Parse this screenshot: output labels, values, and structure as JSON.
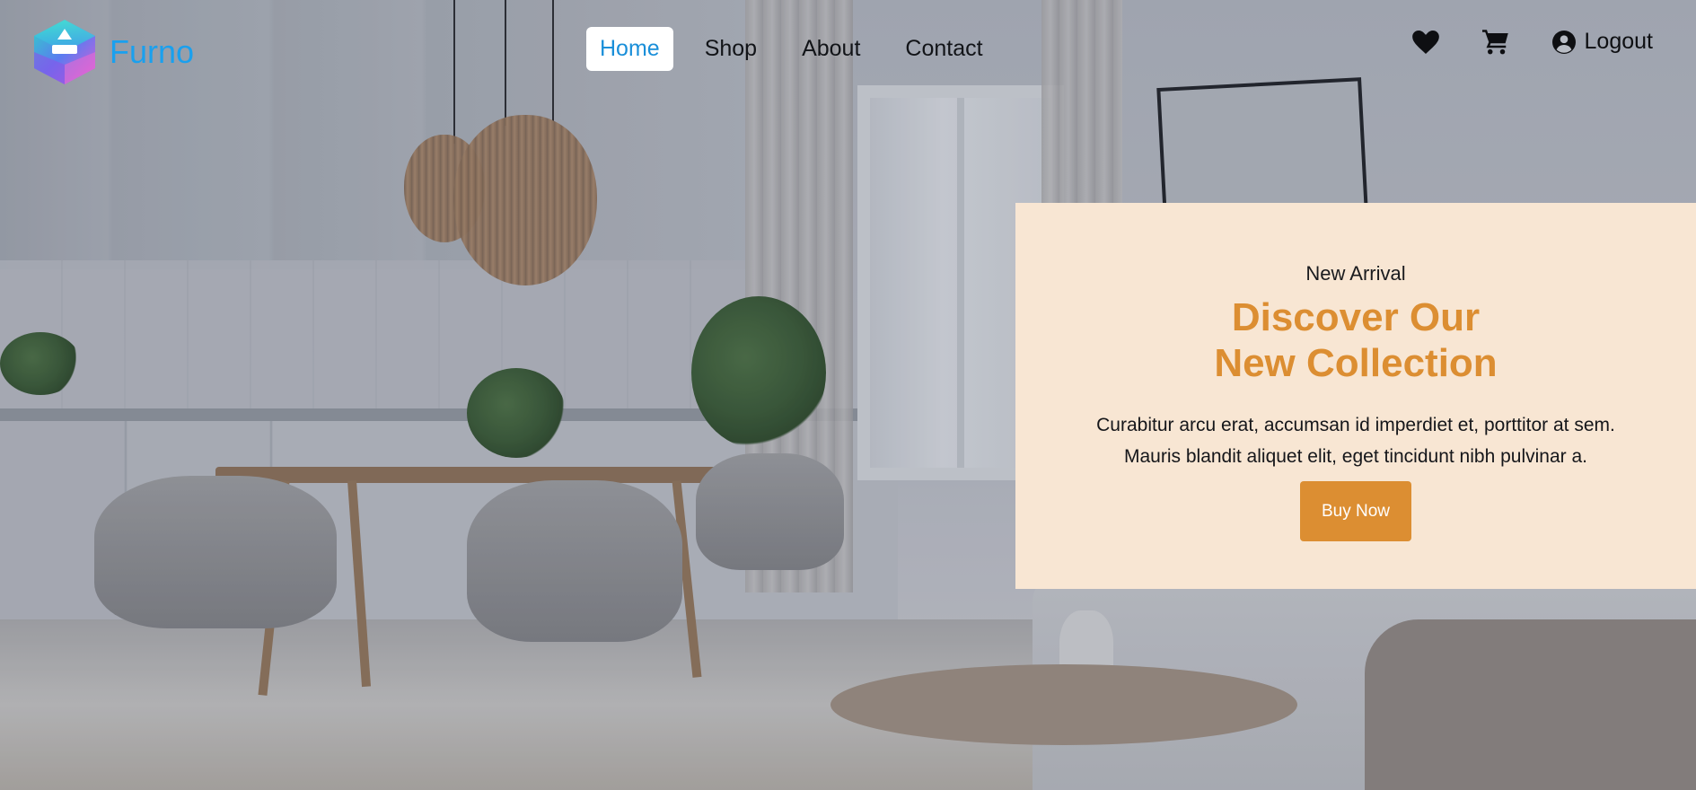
{
  "brand": {
    "name": "Furno",
    "color": "#1aa0ee"
  },
  "nav": {
    "items": [
      {
        "label": "Home",
        "active": true
      },
      {
        "label": "Shop",
        "active": false
      },
      {
        "label": "About",
        "active": false
      },
      {
        "label": "Contact",
        "active": false
      }
    ]
  },
  "actions": {
    "wishlist_icon": "heart-icon",
    "cart_icon": "cart-icon",
    "account_icon": "user-circle-icon",
    "logout_label": "Logout"
  },
  "promo": {
    "kicker": "New Arrival",
    "title_line1": "Discover Our",
    "title_line2": "New Collection",
    "desc_line1": "Curabitur arcu erat, accumsan id imperdiet et, porttitor at sem.",
    "desc_line2": "Mauris blandit aliquet elit, eget tincidunt nibh pulvinar a.",
    "cta_label": "Buy Now",
    "accent_color": "#dc8e32",
    "background_color": "#f8e6d3"
  }
}
